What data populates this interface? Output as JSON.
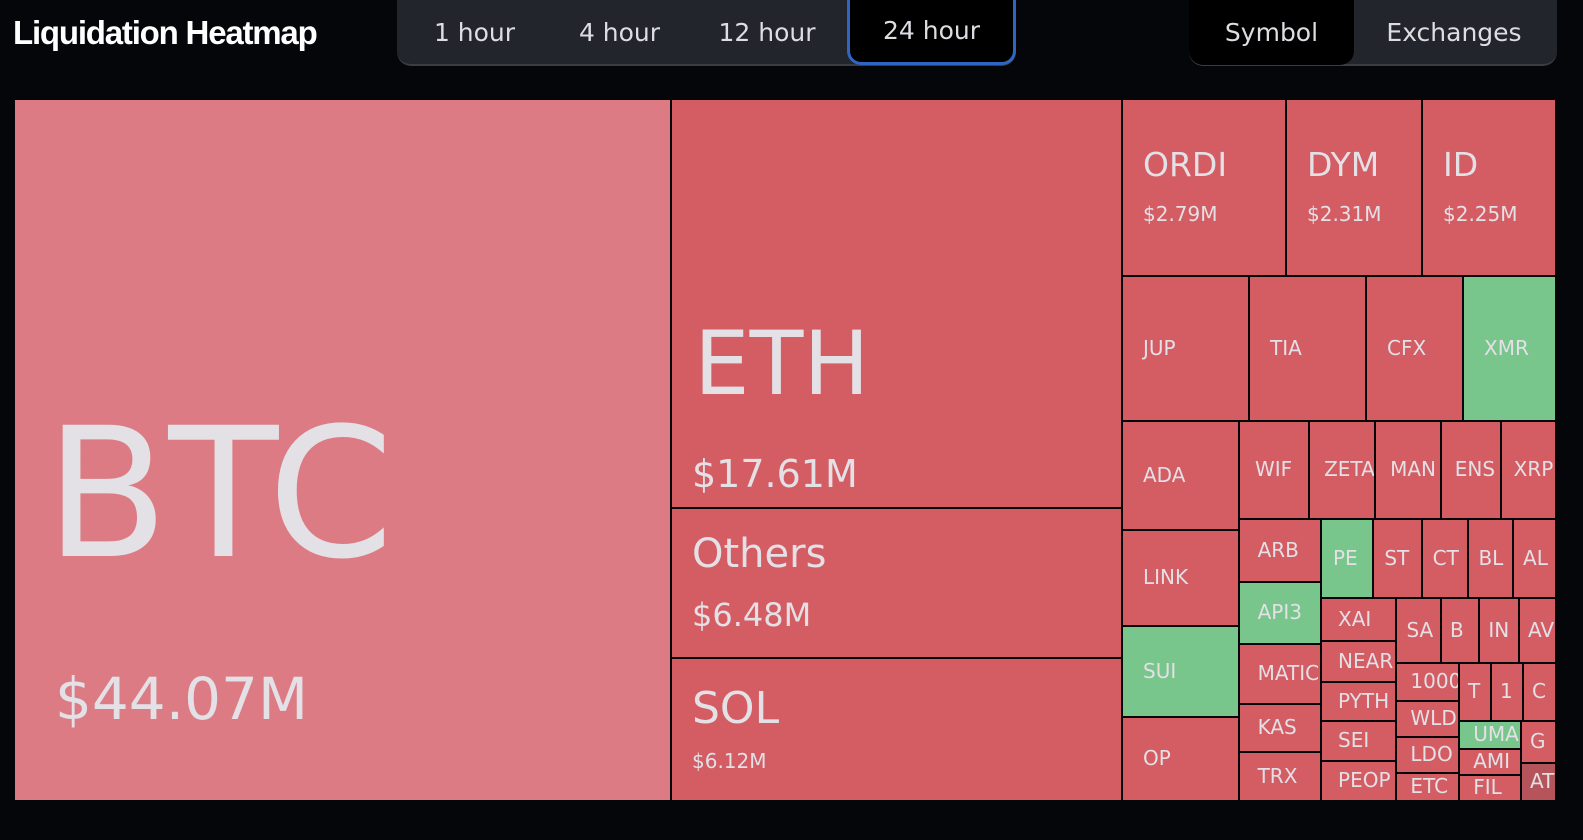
{
  "header": {
    "title": "Liquidation Heatmap",
    "timeframes": [
      "1 hour",
      "4 hour",
      "12 hour",
      "24 hour"
    ],
    "active_timeframe": "24 hour",
    "groupings": [
      "Symbol",
      "Exchanges"
    ],
    "active_grouping": "Symbol"
  },
  "colors": {
    "btc": "#dc7b83",
    "short": "#d45c63",
    "long": "#78c68b",
    "dark": "#b5545a",
    "background": "#05060a",
    "accent": "#2f66c4"
  },
  "tiles": [
    {
      "symbol": "BTC",
      "value": "$44.07M",
      "color": "btc"
    },
    {
      "symbol": "ETH",
      "value": "$17.61M",
      "color": "short"
    },
    {
      "symbol": "Others",
      "value": "$6.48M",
      "color": "short"
    },
    {
      "symbol": "SOL",
      "value": "$6.12M",
      "color": "short"
    },
    {
      "symbol": "ORDI",
      "value": "$2.79M",
      "color": "short"
    },
    {
      "symbol": "DYM",
      "value": "$2.31M",
      "color": "short"
    },
    {
      "symbol": "ID",
      "value": "$2.25M",
      "color": "short"
    },
    {
      "symbol": "JUP",
      "color": "short"
    },
    {
      "symbol": "TIA",
      "color": "short"
    },
    {
      "symbol": "CFX",
      "color": "short"
    },
    {
      "symbol": "XMR",
      "color": "long"
    },
    {
      "symbol": "ADA",
      "color": "short"
    },
    {
      "symbol": "LINK",
      "color": "short"
    },
    {
      "symbol": "SUI",
      "color": "long"
    },
    {
      "symbol": "OP",
      "color": "short"
    },
    {
      "symbol": "WIF",
      "color": "short"
    },
    {
      "symbol": "ZETA",
      "color": "short"
    },
    {
      "symbol": "MAN",
      "color": "short"
    },
    {
      "symbol": "ENS",
      "color": "short"
    },
    {
      "symbol": "XRP",
      "color": "short"
    },
    {
      "symbol": "ARB",
      "color": "short"
    },
    {
      "symbol": "API3",
      "color": "long"
    },
    {
      "symbol": "MATIC",
      "color": "short"
    },
    {
      "symbol": "KAS",
      "color": "short"
    },
    {
      "symbol": "TRX",
      "color": "short"
    },
    {
      "symbol": "PE",
      "color": "long"
    },
    {
      "symbol": "ST",
      "color": "short"
    },
    {
      "symbol": "CT",
      "color": "short"
    },
    {
      "symbol": "BL",
      "color": "short"
    },
    {
      "symbol": "AL",
      "color": "short"
    },
    {
      "symbol": "XAI",
      "color": "short"
    },
    {
      "symbol": "NEAR",
      "color": "short"
    },
    {
      "symbol": "PYTH",
      "color": "short"
    },
    {
      "symbol": "SEI",
      "color": "short"
    },
    {
      "symbol": "PEOP",
      "color": "short"
    },
    {
      "symbol": "SA",
      "color": "short"
    },
    {
      "symbol": "B",
      "color": "short"
    },
    {
      "symbol": "IN",
      "color": "short"
    },
    {
      "symbol": "AV",
      "color": "short"
    },
    {
      "symbol": "1000",
      "color": "short"
    },
    {
      "symbol": "WLD",
      "color": "short"
    },
    {
      "symbol": "LDO",
      "color": "short"
    },
    {
      "symbol": "ETC",
      "color": "short"
    },
    {
      "symbol": "T",
      "color": "short"
    },
    {
      "symbol": "1",
      "color": "short"
    },
    {
      "symbol": "C",
      "color": "short"
    },
    {
      "symbol": "UMA",
      "color": "long"
    },
    {
      "symbol": "AMI",
      "color": "short"
    },
    {
      "symbol": "FIL",
      "color": "short"
    },
    {
      "symbol": "G",
      "color": "short"
    },
    {
      "symbol": "AT",
      "color": "dark"
    }
  ]
}
